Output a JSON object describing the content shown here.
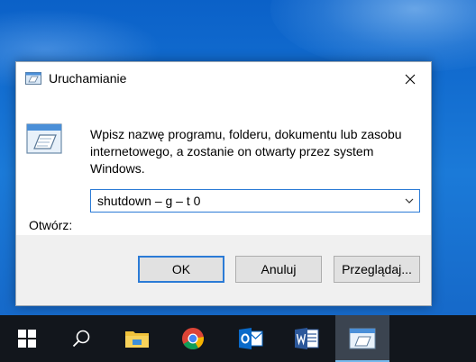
{
  "dialog": {
    "title": "Uruchamianie",
    "description": "Wpisz nazwę programu, folderu, dokumentu lub zasobu internetowego, a zostanie on otwarty przez system Windows.",
    "open_label": "Otwórz:",
    "open_value": "shutdown – g – t 0",
    "buttons": {
      "ok": "OK",
      "cancel": "Anuluj",
      "browse": "Przeglądaj..."
    },
    "icons": {
      "title": "run-icon",
      "large": "run-icon",
      "close": "close-icon",
      "dropdown": "chevron-down-icon"
    }
  },
  "taskbar": {
    "items": [
      {
        "icon": "windows-start-icon"
      },
      {
        "icon": "search-icon"
      },
      {
        "icon": "file-explorer-icon"
      },
      {
        "icon": "chrome-icon"
      },
      {
        "icon": "outlook-icon"
      },
      {
        "icon": "word-icon"
      },
      {
        "icon": "run-icon",
        "active": true
      }
    ]
  },
  "colors": {
    "accent": "#2b7bd6",
    "taskbar": "#12161c",
    "dialog_bg": "#f0f0f0"
  }
}
